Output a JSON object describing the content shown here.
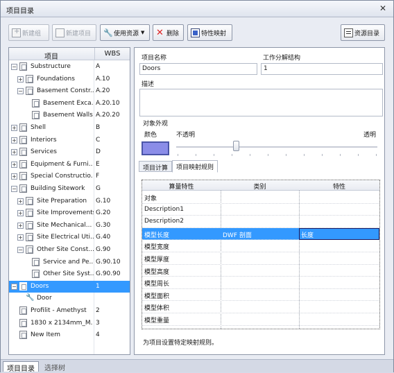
{
  "window": {
    "title": "项目目录"
  },
  "toolbar": {
    "new_group": "新建组",
    "new_item": "新建项目",
    "use_resource": "使用资源",
    "delete": "删除",
    "property_mapping": "特性映射",
    "resource_catalog": "资源目录"
  },
  "tree": {
    "col_item": "项目",
    "col_wbs": "WBS",
    "rows": [
      {
        "name": "Substructure",
        "wbs": "A"
      },
      {
        "name": "Foundations",
        "wbs": "A.10"
      },
      {
        "name": "Basement Constr...",
        "wbs": "A.20"
      },
      {
        "name": "Basement Exca...",
        "wbs": "A.20.10"
      },
      {
        "name": "Basement Walls",
        "wbs": "A.20.20"
      },
      {
        "name": "Shell",
        "wbs": "B"
      },
      {
        "name": "Interiors",
        "wbs": "C"
      },
      {
        "name": "Services",
        "wbs": "D"
      },
      {
        "name": "Equipment & Furni...",
        "wbs": "E"
      },
      {
        "name": "Special Constructio...",
        "wbs": "F"
      },
      {
        "name": "Building Sitework",
        "wbs": "G"
      },
      {
        "name": "Site Preparation",
        "wbs": "G.10"
      },
      {
        "name": "Site Improvements",
        "wbs": "G.20"
      },
      {
        "name": "Site Mechanical...",
        "wbs": "G.30"
      },
      {
        "name": "Site Electrical Uti...",
        "wbs": "G.40"
      },
      {
        "name": "Other Site Const...",
        "wbs": "G.90"
      },
      {
        "name": "Service and Pe...",
        "wbs": "G.90.10"
      },
      {
        "name": "Other Site Syst...",
        "wbs": "G.90.90"
      },
      {
        "name": "Doors",
        "wbs": "1"
      },
      {
        "name": "Door",
        "wbs": ""
      },
      {
        "name": "Profilit - Amethyst",
        "wbs": "2"
      },
      {
        "name": "1830 x 2134mm_M...",
        "wbs": "3"
      },
      {
        "name": "New Item",
        "wbs": "4"
      }
    ]
  },
  "form": {
    "item_name_label": "项目名称",
    "item_name_value": "Doors",
    "wbs_label": "工作分解结构",
    "wbs_value": "1",
    "description_label": "描述",
    "appearance_label": "对象外观",
    "color_label": "颜色",
    "opaque_label": "不透明",
    "transparent_label": "透明",
    "swatch_color": "#8b8de8",
    "transparency_percent": 30
  },
  "tabs": {
    "calc": "项目计算",
    "mapping": "项目映射规则"
  },
  "mapping_grid": {
    "headers": [
      "算量特性",
      "类别",
      "特性"
    ],
    "rows": [
      {
        "prop": "对象",
        "cat": "",
        "val": ""
      },
      {
        "prop": "Description1",
        "cat": "",
        "val": ""
      },
      {
        "prop": "Description2",
        "cat": "",
        "val": ""
      },
      {
        "prop": "模型长度",
        "cat": "DWF 剖面",
        "val": "长度"
      },
      {
        "prop": "模型宽度",
        "cat": "",
        "val": ""
      },
      {
        "prop": "模型厚度",
        "cat": "",
        "val": ""
      },
      {
        "prop": "模型高度",
        "cat": "",
        "val": ""
      },
      {
        "prop": "模型周长",
        "cat": "",
        "val": ""
      },
      {
        "prop": "模型面积",
        "cat": "",
        "val": ""
      },
      {
        "prop": "模型体积",
        "cat": "",
        "val": ""
      },
      {
        "prop": "模型重量",
        "cat": "",
        "val": ""
      }
    ],
    "note": "为项目设置特定映射规则。"
  },
  "bottom_tabs": {
    "catalog": "项目目录",
    "selection_tree": "选择树"
  }
}
